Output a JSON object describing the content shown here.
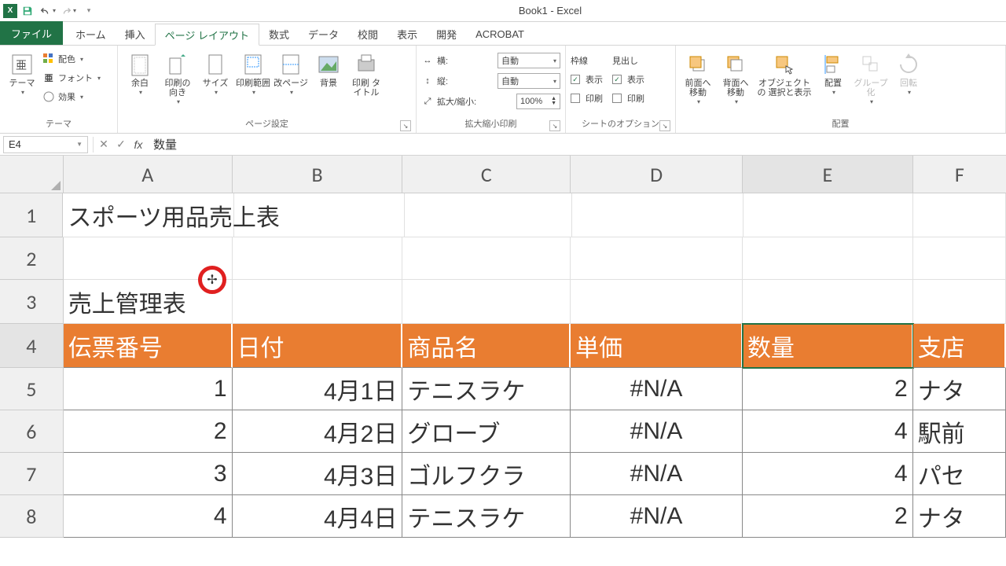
{
  "app": {
    "title": "Book1 - Excel",
    "logo": "X"
  },
  "qat": {
    "save": "save-icon",
    "undo": "undo-icon",
    "redo": "redo-icon"
  },
  "tabs": {
    "file": "ファイル",
    "items": [
      "ホーム",
      "挿入",
      "ページ レイアウト",
      "数式",
      "データ",
      "校閲",
      "表示",
      "開発",
      "ACROBAT"
    ],
    "active_index": 2
  },
  "ribbon": {
    "theme": {
      "label": "テーマ",
      "themes": "テーマ",
      "colors": "配色",
      "fonts": "フォント",
      "effects": "効果"
    },
    "page_setup": {
      "label": "ページ設定",
      "margins": "余白",
      "orientation": "印刷の\n向き",
      "size": "サイズ",
      "print_area": "印刷範囲",
      "breaks": "改ページ",
      "background": "背景",
      "print_titles": "印刷\nタイトル"
    },
    "scale": {
      "label": "拡大縮小印刷",
      "width_lbl": "横:",
      "height_lbl": "縦:",
      "scale_lbl": "拡大/縮小:",
      "auto": "自動",
      "pct": "100%"
    },
    "sheet_opts": {
      "label": "シートのオプション",
      "gridlines": "枠線",
      "headings": "見出し",
      "view": "表示",
      "print": "印刷"
    },
    "arrange": {
      "label": "配置",
      "bring_fwd": "前面へ\n移動",
      "send_back": "背面へ\n移動",
      "selection": "オブジェクトの\n選択と表示",
      "align": "配置",
      "group": "グループ化",
      "rotate": "回転"
    }
  },
  "formula_bar": {
    "name": "E4",
    "fx": "fx",
    "value": "数量"
  },
  "columns": [
    "A",
    "B",
    "C",
    "D",
    "E",
    "F"
  ],
  "row_nums": [
    1,
    2,
    3,
    4,
    5,
    6,
    7,
    8
  ],
  "selected_col": 4,
  "selected_row": 3,
  "sheet": {
    "title1": "スポーツ用品売上表",
    "title2": "売上管理表",
    "headers": [
      "伝票番号",
      "日付",
      "商品名",
      "単価",
      "数量",
      "支店"
    ],
    "rows": [
      {
        "no": 1,
        "date": "4月1日",
        "item": "テニスラケ",
        "price": "#N/A",
        "qty": 2,
        "branch": "ナタ"
      },
      {
        "no": 2,
        "date": "4月2日",
        "item": "グローブ",
        "price": "#N/A",
        "qty": 4,
        "branch": "駅前"
      },
      {
        "no": 3,
        "date": "4月3日",
        "item": "ゴルフクラ",
        "price": "#N/A",
        "qty": 4,
        "branch": "パセ"
      },
      {
        "no": 4,
        "date": "4月4日",
        "item": "テニスラケ",
        "price": "#N/A",
        "qty": 2,
        "branch": "ナタ"
      }
    ]
  }
}
